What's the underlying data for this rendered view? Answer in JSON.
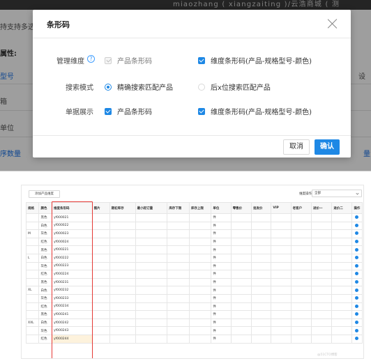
{
  "background": {
    "topbar_text": "miaozhang ( xiangzaiting )/云浩商城 (  测",
    "hint_text": "持支持多选。",
    "attr_label": "属性:",
    "field_model": "型号",
    "field_setting": "设",
    "field_col_a": "箱",
    "field_unit": "单位",
    "field_count": "序数量",
    "field_right_e": "量"
  },
  "modal": {
    "title": "条形码",
    "rows": [
      {
        "label": "管理维度",
        "options": [
          {
            "text": "产品条形码",
            "state": "disabled-checked"
          },
          {
            "text": "维度条形码(产品-规格型号-颜色)",
            "state": "checked"
          }
        ]
      },
      {
        "label": "搜索模式",
        "options": [
          {
            "text": "精确搜索匹配产品",
            "state": "selected"
          },
          {
            "text": "后x位搜索匹配产品",
            "state": "unselected"
          }
        ]
      },
      {
        "label": "单据展示",
        "options": [
          {
            "text": "产品条形码",
            "state": "checked"
          },
          {
            "text": "维度条形码(产品-规格型号-颜色)",
            "state": "checked"
          }
        ]
      }
    ],
    "cancel_label": "取消",
    "confirm_label": "确认"
  },
  "table_panel": {
    "add_button": "添加产品维度",
    "dimension_op_label": "维度操作",
    "dimension_select": "全部",
    "headers": [
      "规格",
      "颜色",
      "维度条形码",
      "图片",
      "期初库存",
      "最小起订量",
      "库存下限",
      "库存上限",
      "单位",
      "零售价",
      "批发价",
      "VIP",
      "老客户",
      "进价一",
      "进价二",
      "操作"
    ],
    "rows": [
      {
        "size": "",
        "color": "黑色",
        "barcode": "yf000021",
        "unit": "件"
      },
      {
        "size": "",
        "color": "白色",
        "barcode": "yf000022",
        "unit": "件"
      },
      {
        "size": "M",
        "color": "灰色",
        "barcode": "yf000023",
        "unit": "件"
      },
      {
        "size": "",
        "color": "红色",
        "barcode": "yf000024",
        "unit": "件"
      },
      {
        "size": "",
        "color": "黑色",
        "barcode": "yf000221",
        "unit": "件"
      },
      {
        "size": "L",
        "color": "白色",
        "barcode": "yf000222",
        "unit": "件"
      },
      {
        "size": "",
        "color": "灰色",
        "barcode": "yf000223",
        "unit": "件"
      },
      {
        "size": "",
        "color": "红色",
        "barcode": "yf000224",
        "unit": "件"
      },
      {
        "size": "",
        "color": "黑色",
        "barcode": "yf000231",
        "unit": "件"
      },
      {
        "size": "XL",
        "color": "白色",
        "barcode": "yf000232",
        "unit": "件"
      },
      {
        "size": "",
        "color": "灰色",
        "barcode": "yf000233",
        "unit": "件"
      },
      {
        "size": "",
        "color": "红色",
        "barcode": "yf000234",
        "unit": "件"
      },
      {
        "size": "",
        "color": "黑色",
        "barcode": "yf000241",
        "unit": "件"
      },
      {
        "size": "XXL",
        "color": "白色",
        "barcode": "yf000242",
        "unit": "件"
      },
      {
        "size": "",
        "color": "灰色",
        "barcode": "yf000243",
        "unit": "件"
      },
      {
        "size": "",
        "color": "红色",
        "barcode": "yf000244",
        "unit": "件"
      }
    ],
    "watermark": "@51CTO博客"
  },
  "colors": {
    "accent": "#1e88e5",
    "highlight_box": "#e53935"
  }
}
